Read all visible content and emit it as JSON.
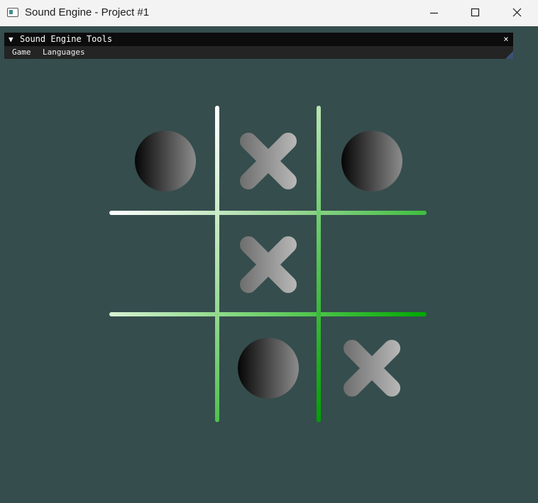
{
  "window": {
    "title": "Sound Engine - Project #1",
    "icons": {
      "minimize": "minimize-icon",
      "maximize": "maximize-icon",
      "close": "close-icon"
    }
  },
  "tools_panel": {
    "collapse_glyph": "▼",
    "title": "Sound Engine Tools",
    "close_glyph": "×",
    "menu": [
      "Game",
      "Languages"
    ]
  },
  "board": {
    "cells": [
      [
        "O",
        "X",
        "O"
      ],
      [
        "",
        "X",
        ""
      ],
      [
        "",
        "O",
        "X"
      ]
    ]
  },
  "colors": {
    "background": "#354d4d",
    "grid_start": "#ffffff",
    "grid_end": "#00a000"
  }
}
